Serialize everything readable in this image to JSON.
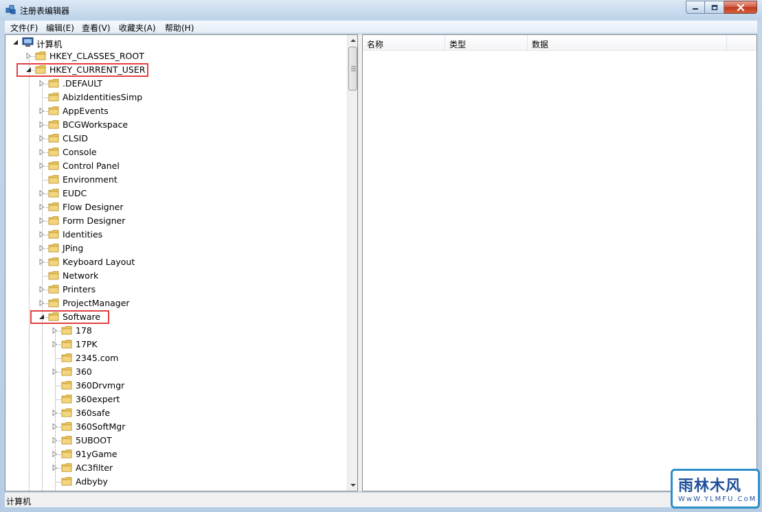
{
  "window": {
    "title": "注册表编辑器"
  },
  "menu": [
    "文件(F)",
    "编辑(E)",
    "查看(V)",
    "收藏夹(A)",
    "帮助(H)"
  ],
  "tree": [
    {
      "label": "计算机",
      "level": 0,
      "exp": "open"
    },
    {
      "label": "HKEY_CLASSES_ROOT",
      "level": 1,
      "exp": "closed"
    },
    {
      "label": "HKEY_CURRENT_USER",
      "level": 1,
      "exp": "open"
    },
    {
      "label": ".DEFAULT",
      "level": 2,
      "exp": "closed"
    },
    {
      "label": "AbizIdentitiesSimp",
      "level": 2,
      "exp": "none"
    },
    {
      "label": "AppEvents",
      "level": 2,
      "exp": "closed"
    },
    {
      "label": "BCGWorkspace",
      "level": 2,
      "exp": "closed"
    },
    {
      "label": "CLSID",
      "level": 2,
      "exp": "closed"
    },
    {
      "label": "Console",
      "level": 2,
      "exp": "closed"
    },
    {
      "label": "Control Panel",
      "level": 2,
      "exp": "closed"
    },
    {
      "label": "Environment",
      "level": 2,
      "exp": "none"
    },
    {
      "label": "EUDC",
      "level": 2,
      "exp": "closed"
    },
    {
      "label": "Flow Designer",
      "level": 2,
      "exp": "closed"
    },
    {
      "label": "Form Designer",
      "level": 2,
      "exp": "closed"
    },
    {
      "label": "Identities",
      "level": 2,
      "exp": "closed"
    },
    {
      "label": "JPing",
      "level": 2,
      "exp": "closed"
    },
    {
      "label": "Keyboard Layout",
      "level": 2,
      "exp": "closed"
    },
    {
      "label": "Network",
      "level": 2,
      "exp": "none"
    },
    {
      "label": "Printers",
      "level": 2,
      "exp": "closed"
    },
    {
      "label": "ProjectManager",
      "level": 2,
      "exp": "closed"
    },
    {
      "label": "Software",
      "level": 2,
      "exp": "open"
    },
    {
      "label": "178",
      "level": 3,
      "exp": "closed"
    },
    {
      "label": "17PK",
      "level": 3,
      "exp": "closed"
    },
    {
      "label": "2345.com",
      "level": 3,
      "exp": "none"
    },
    {
      "label": "360",
      "level": 3,
      "exp": "closed"
    },
    {
      "label": "360Drvmgr",
      "level": 3,
      "exp": "none"
    },
    {
      "label": "360expert",
      "level": 3,
      "exp": "none"
    },
    {
      "label": "360safe",
      "level": 3,
      "exp": "closed"
    },
    {
      "label": "360SoftMgr",
      "level": 3,
      "exp": "closed"
    },
    {
      "label": "5UBOOT",
      "level": 3,
      "exp": "closed"
    },
    {
      "label": "91yGame",
      "level": 3,
      "exp": "closed"
    },
    {
      "label": "AC3filter",
      "level": 3,
      "exp": "closed"
    },
    {
      "label": "Adbyby",
      "level": 3,
      "exp": "none"
    }
  ],
  "columns": [
    "名称",
    "类型",
    "数据"
  ],
  "status": {
    "text": "计算机"
  },
  "watermark": {
    "main": "雨林木风",
    "sub": "WwW.YLMFU.CoM"
  },
  "colors": {
    "highlight": "#e1403f",
    "folder": "#e8c35a"
  }
}
